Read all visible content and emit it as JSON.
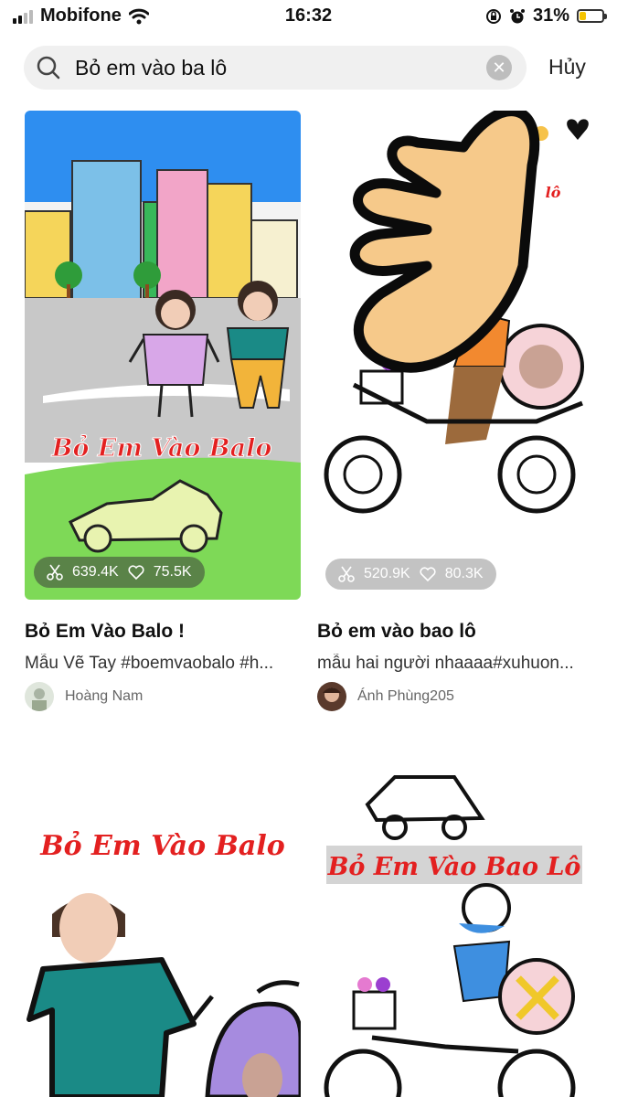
{
  "status_bar": {
    "carrier": "Mobifone",
    "time": "16:32",
    "battery": "31%",
    "battery_level": 0.31
  },
  "search": {
    "query": "Bỏ em vào ba lô",
    "cancel_label": "Hủy"
  },
  "cards": [
    {
      "title": "Bỏ Em Vào Balo !",
      "description": "Mẫu Vẽ Tay #boemvaobalo #h...",
      "author": "Hoàng Nam",
      "uses": "639.4K",
      "likes": "75.5K",
      "poster_text": "Bỏ Em Vào Balo"
    },
    {
      "title": "Bỏ em vào bao lô",
      "description": "mẫu hai người nhaaaa#xuhuon...",
      "author": "Ánh Phùng205",
      "uses": "520.9K",
      "likes": "80.3K",
      "poster_text": "lô"
    },
    {
      "poster_text": "Bỏ Em Vào Balo"
    },
    {
      "poster_text": "Bỏ Em Vào Bao Lô"
    }
  ]
}
